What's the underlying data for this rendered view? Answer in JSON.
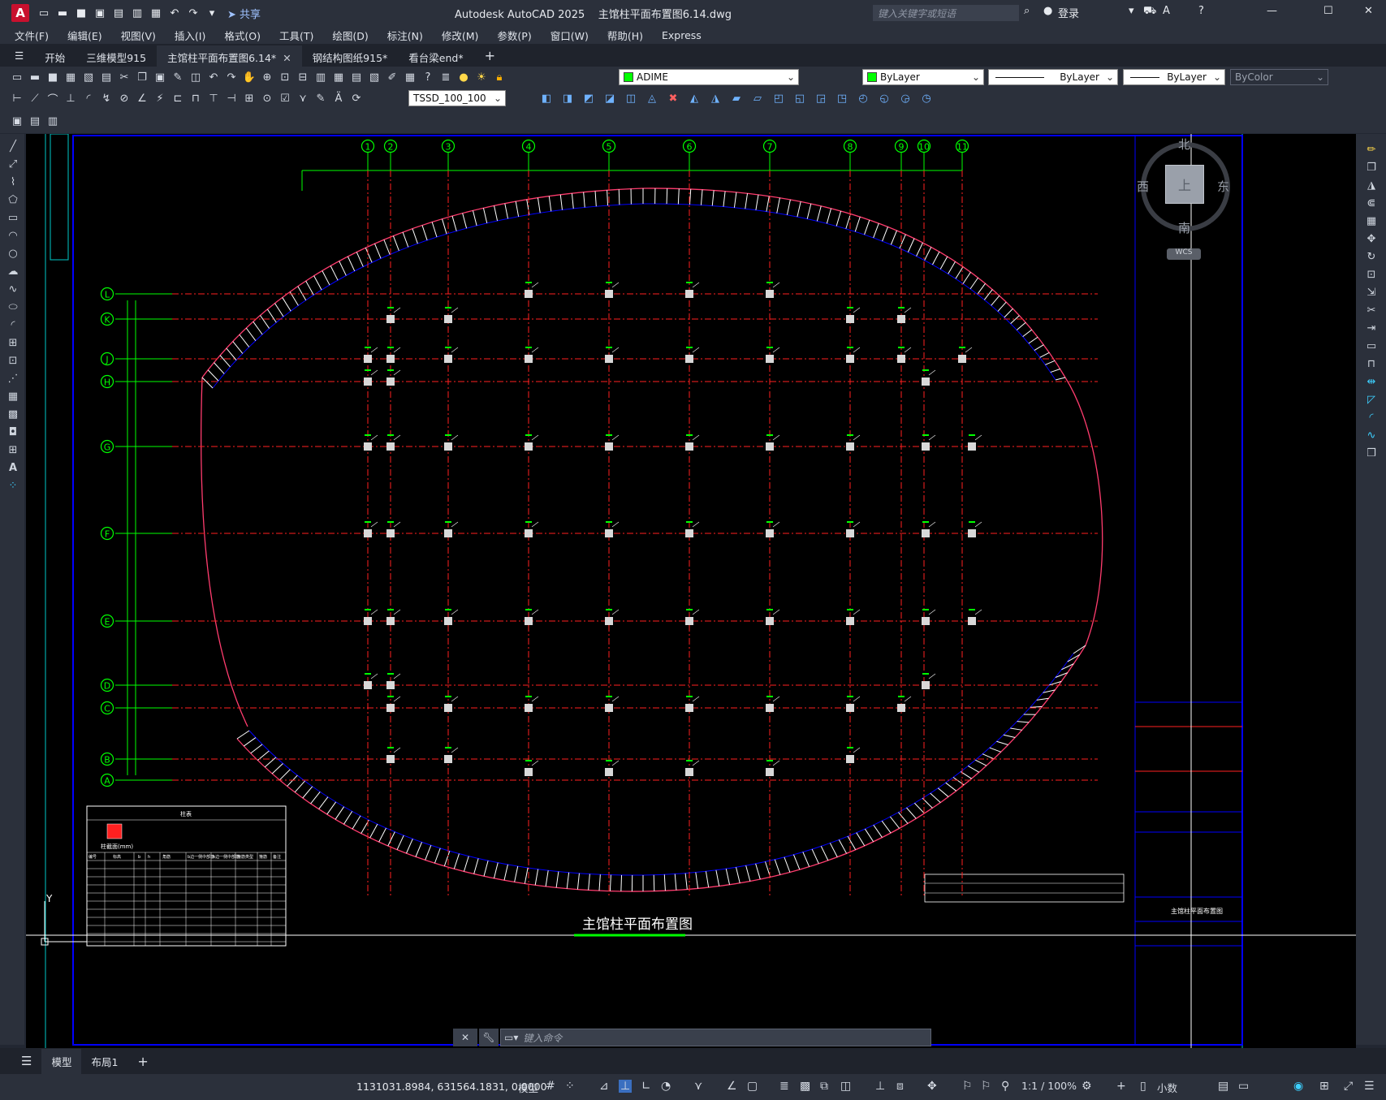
{
  "app": {
    "logo": "A",
    "product": "Autodesk AutoCAD 2025",
    "document": "主馆柱平面布置图6.14.dwg",
    "share_label": "共享",
    "search_placeholder": "键入关键字或短语",
    "sign_in": "登录"
  },
  "menu": [
    "文件(F)",
    "编辑(E)",
    "视图(V)",
    "插入(I)",
    "格式(O)",
    "工具(T)",
    "绘图(D)",
    "标注(N)",
    "修改(M)",
    "参数(P)",
    "窗口(W)",
    "帮助(H)",
    "Express"
  ],
  "doc_tabs": [
    {
      "label": "开始",
      "active": false
    },
    {
      "label": "三维模型915",
      "active": false
    },
    {
      "label": "主馆柱平面布置图6.14*",
      "active": true
    },
    {
      "label": "钢结构图纸915*",
      "active": false
    },
    {
      "label": "看台梁end*",
      "active": false
    }
  ],
  "properties": {
    "layer": "ADIME",
    "color": "ByLayer",
    "linetype": "ByLayer",
    "lineweight": "ByLayer",
    "plotstyle": "ByColor",
    "dimstyle": "TSSD_100_100",
    "layer_color": "#00ff00"
  },
  "viewcube": {
    "north": "北",
    "south": "南",
    "east": "东",
    "west": "西",
    "top": "上",
    "wcs": "WCS"
  },
  "drawing": {
    "title": "主馆柱平面布置图",
    "col_axes": [
      "1",
      "2",
      "3",
      "4",
      "5",
      "6",
      "7",
      "8",
      "9",
      "10",
      "11"
    ],
    "row_axes": [
      "L",
      "K",
      "J",
      "H",
      "G",
      "F",
      "E",
      "D",
      "C",
      "B",
      "A"
    ],
    "table_title": "柱表",
    "table_subtitle": "柱截面(mm)",
    "table_headers": [
      "编号",
      "标高",
      "b",
      "h",
      "角筋",
      "b边一侧中部筋",
      "h边一侧中部筋",
      "箍筋类型",
      "箍筋",
      "备注"
    ],
    "title_block_name": "主馆柱平面布置图",
    "colors": {
      "axis": "#ff2020",
      "grid_green": "#00ff00",
      "frame": "#0000ff",
      "curve": "#ff3c6e",
      "tick": "#ffffff"
    }
  },
  "layout_tabs": [
    "模型",
    "布局1"
  ],
  "command": {
    "placeholder": "键入命令"
  },
  "status": {
    "coords": "1131031.8984, 631564.1831, 0.0000",
    "model": "模型",
    "scale": "1:1 / 100%",
    "units": "小数"
  }
}
